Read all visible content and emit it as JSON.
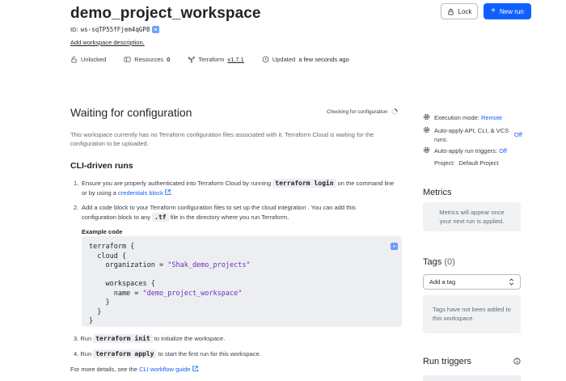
{
  "header": {
    "title": "demo_project_workspace",
    "id_label": "ID:",
    "id_value": "ws-sqTP55fFjem4qGP8",
    "description_link": "Add workspace description.",
    "lock_label": "Lock",
    "new_run_label": "New run"
  },
  "meta": {
    "lock_state": "Unlocked",
    "resources_label": "Resources",
    "resources_count": "0",
    "terraform_label": "Terraform",
    "terraform_version": "v1.7.1",
    "updated_prefix": "Updated",
    "updated_value": "a few seconds ago"
  },
  "main": {
    "heading": "Waiting for configuration",
    "status": "Checking for configuration",
    "intro": "This workspace currently has no Terraform configuration files associated with it. Terraform Cloud is waiting for the configuration to be uploaded.",
    "cli_heading": "CLI-driven runs",
    "step1_a": "Ensure you are properly authenticated into Terraform Cloud by running",
    "step1_code": "terraform login",
    "step1_b": "on the command line",
    "step1_c": "or by using a",
    "step1_link": "credentials block",
    "step2_a": "Add a code block to your Terraform configuration files to set up the cloud integration . You can add this",
    "step2_b": "configuration block to any",
    "step2_code": ".tf",
    "step2_c": "file in the directory where you run Terraform.",
    "example_label": "Example code",
    "code_lines": [
      "terraform {",
      "  cloud {",
      "    organization = ",
      "",
      "    workspaces {",
      "      name = ",
      "    }",
      "  }",
      "}"
    ],
    "org_value": "\"Shak_demo_projects\"",
    "ws_value": "\"demo_project_workspace\"",
    "step3_a": "Run",
    "step3_code": "terraform init",
    "step3_b": "to initialize the workspace.",
    "step4_a": "Run",
    "step4_code": "terraform apply",
    "step4_b": "to start the first run for this workspace.",
    "footer_a": "For more details, see the",
    "footer_link": "CLI workflow guide",
    "n1": "1.",
    "n2": "2.",
    "n3": "3.",
    "n4": "4."
  },
  "sidebar": {
    "exec_label": "Execution mode:",
    "exec_value": "Remote",
    "auto_apply_label": "Auto-apply API, CLI, & VCS runs:",
    "auto_apply_value": "Off",
    "auto_triggers_label": "Auto-apply run triggers:",
    "auto_triggers_value": "Off",
    "project_label": "Project:",
    "project_value": "Default Project",
    "metrics_heading": "Metrics",
    "metrics_text": "Metrics will appear once your next run is applied.",
    "tags_heading": "Tags",
    "tags_count": "(0)",
    "add_tag_label": "Add a tag",
    "tags_empty": "Tags have not been added to this workspace.",
    "run_triggers_heading": "Run triggers"
  },
  "icons": {
    "copy": "copy-icon",
    "unlock": "unlock-icon",
    "resources": "resources-icon",
    "terraform": "terraform-icon",
    "history": "history-icon",
    "lock": "lock-icon",
    "plus": "plus-icon",
    "external": "external-link-icon",
    "spinner": "spinner-icon",
    "info": "info-icon",
    "gear": "gear-icon",
    "chevron": "chevron-down-icon"
  },
  "colors": {
    "accent": "#1060ff",
    "panel": "#f1f2f3",
    "string": "#6f2dbd"
  }
}
